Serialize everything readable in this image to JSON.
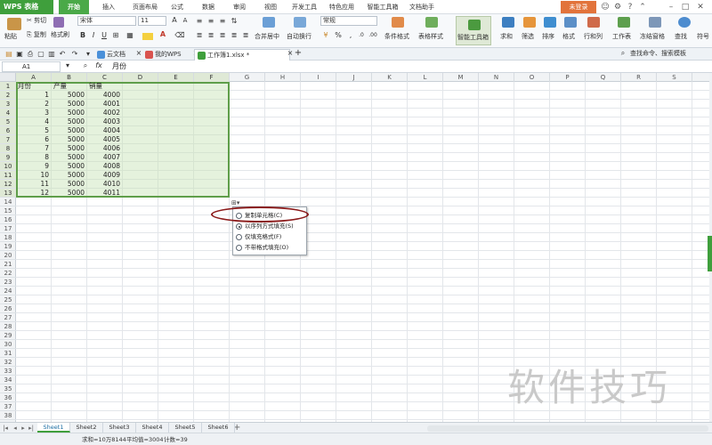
{
  "menubar": {
    "app_name": "WPS 表格",
    "items": [
      "开始",
      "插入",
      "页面布局",
      "公式",
      "数据",
      "审阅",
      "视图",
      "开发工具",
      "特色应用",
      "智能工具箱",
      "文档助手"
    ],
    "active": "开始",
    "login": "未登录",
    "colors": {
      "brand": "#3f9f3c",
      "login": "#e2733b"
    }
  },
  "ribbon": {
    "paste": "粘贴",
    "cut": "剪切",
    "copy": "复制",
    "format_painter": "格式刷",
    "font_name": "宋体",
    "font_size": "11",
    "number_format": "常规",
    "merge_center": "合并居中",
    "wrap": "自动换行",
    "conditional_format": "条件格式",
    "table_style": "表格样式",
    "smart_toolbox": "智能工具箱",
    "sum": "求和",
    "filter": "筛选",
    "sort": "排序",
    "format": "格式",
    "row_col": "行和列",
    "worksheet": "工作表",
    "freeze": "冻结窗格",
    "find": "查找",
    "symbol": "符号",
    "bold": "B",
    "italic": "I",
    "underline": "U",
    "percent": "%"
  },
  "docbar": {
    "tabs": [
      {
        "label": "云文档",
        "icon": "cloud-icon"
      },
      {
        "label": "我的WPS",
        "icon": "wps-icon"
      },
      {
        "label": "工作簿1.xlsx *",
        "icon": "sheet-file-icon",
        "active": true
      }
    ],
    "add": "+",
    "search_hint": "查找命令、搜索模板"
  },
  "formula_bar": {
    "cell_ref": "A1",
    "fx": "fx",
    "content": "月份"
  },
  "grid": {
    "columns": [
      "A",
      "B",
      "C",
      "D",
      "E",
      "F",
      "G",
      "H",
      "I",
      "J",
      "K",
      "L",
      "M",
      "N",
      "O",
      "P",
      "Q",
      "R",
      "S"
    ],
    "rows": [
      "1",
      "2",
      "3",
      "4",
      "5",
      "6",
      "7",
      "8",
      "9",
      "10",
      "11",
      "12",
      "13",
      "14",
      "15",
      "16",
      "17",
      "18",
      "19",
      "20",
      "21",
      "22",
      "23",
      "24",
      "25",
      "26",
      "27",
      "28",
      "29",
      "30",
      "31",
      "32",
      "33",
      "34",
      "35",
      "36",
      "37",
      "38"
    ],
    "headers": [
      "月份",
      "产量",
      "销量"
    ],
    "data": [
      [
        1,
        5000,
        4000
      ],
      [
        2,
        5000,
        4001
      ],
      [
        3,
        5000,
        4002
      ],
      [
        4,
        5000,
        4003
      ],
      [
        5,
        5000,
        4004
      ],
      [
        6,
        5000,
        4005
      ],
      [
        7,
        5000,
        4006
      ],
      [
        8,
        5000,
        4007
      ],
      [
        9,
        5000,
        4008
      ],
      [
        10,
        5000,
        4009
      ],
      [
        11,
        5000,
        4010
      ],
      [
        12,
        5000,
        4011
      ]
    ]
  },
  "autofill_menu": {
    "options": [
      {
        "label": "复制单元格(C)",
        "selected": false
      },
      {
        "label": "以序列方式填充(S)",
        "selected": true
      },
      {
        "label": "仅填充格式(F)",
        "selected": false
      },
      {
        "label": "不带格式填充(O)",
        "selected": false
      }
    ],
    "highlight_color": "#8b1a1a"
  },
  "sheets": [
    "Sheet1",
    "Sheet2",
    "Sheet3",
    "Sheet4",
    "Sheet5",
    "Sheet6"
  ],
  "active_sheet": "Sheet1",
  "status": {
    "sum": "求和=10万8144",
    "avg": "平均值=3004",
    "count": "计数=39"
  },
  "watermark": "软件技巧"
}
